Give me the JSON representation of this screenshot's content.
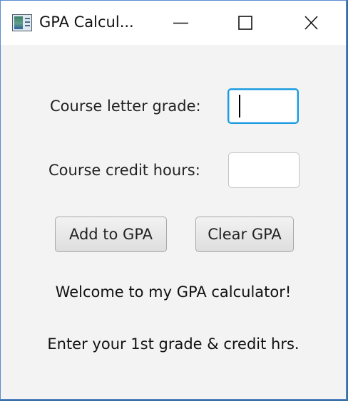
{
  "window": {
    "title": "GPA Calcul...",
    "icon": "java-app-icon",
    "controls": [
      "minimize-icon",
      "maximize-icon",
      "close-icon"
    ]
  },
  "form": {
    "grade_label": "Course letter grade:",
    "grade_value": "",
    "hours_label": "Course credit hours:",
    "hours_value": ""
  },
  "buttons": {
    "add_label": "Add to GPA",
    "clear_label": "Clear GPA"
  },
  "messages": {
    "welcome": "Welcome to my GPA calculator!",
    "prompt": "Enter your 1st grade & credit hrs."
  },
  "colors": {
    "focus_border": "#1a9be0",
    "window_bg": "#f3f3f3",
    "titlebar_bg": "#ffffff"
  }
}
